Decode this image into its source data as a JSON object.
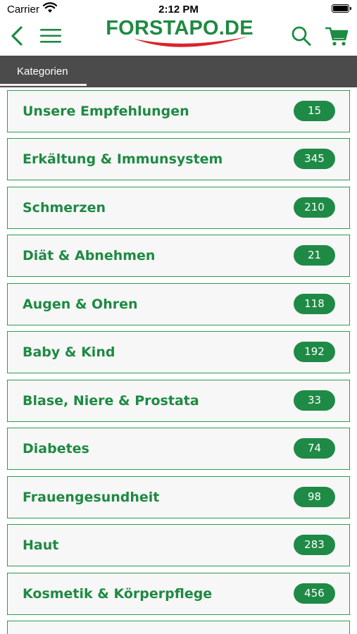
{
  "status_bar": {
    "carrier": "Carrier",
    "time": "2:12 PM"
  },
  "header": {
    "logo_text": "FORSTAPO.DE",
    "icons": [
      "back-icon",
      "menu-icon",
      "search-icon",
      "cart-icon"
    ]
  },
  "tabs": {
    "active_label": "Kategorien"
  },
  "categories": [
    {
      "label": "Unsere Empfehlungen",
      "count": "15"
    },
    {
      "label": "Erkältung & Immunsystem",
      "count": "345"
    },
    {
      "label": "Schmerzen",
      "count": "210"
    },
    {
      "label": "Diät & Abnehmen",
      "count": "21"
    },
    {
      "label": "Augen & Ohren",
      "count": "118"
    },
    {
      "label": "Baby & Kind",
      "count": "192"
    },
    {
      "label": "Blase, Niere & Prostata",
      "count": "33"
    },
    {
      "label": "Diabetes",
      "count": "74"
    },
    {
      "label": "Frauengesundheit",
      "count": "98"
    },
    {
      "label": "Haut",
      "count": "283"
    },
    {
      "label": "Kosmetik & Körperpflege",
      "count": "456"
    },
    {
      "label": "",
      "count": ""
    }
  ],
  "colors": {
    "brand_green": "#1e8a42",
    "logo_red": "#d9252a",
    "tab_bar": "#4b4b4b"
  }
}
